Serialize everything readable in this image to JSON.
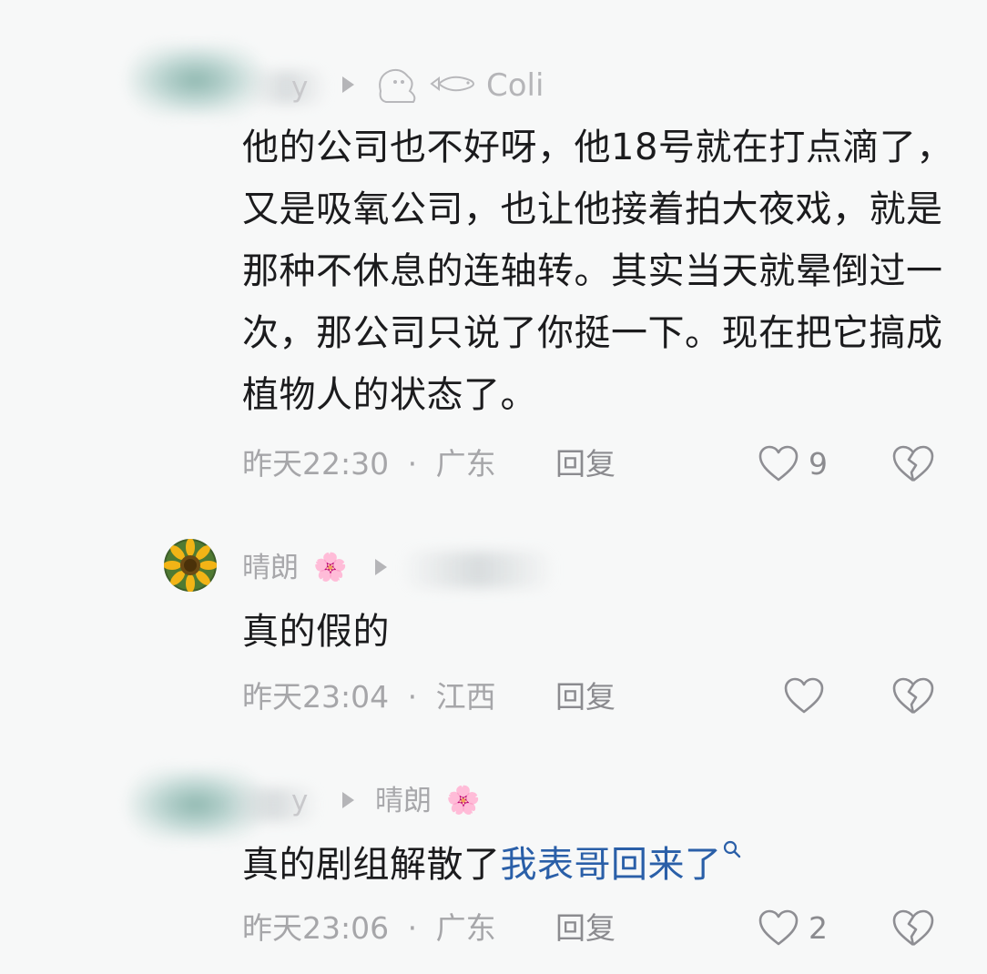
{
  "comments": [
    {
      "username": "y",
      "username_suffix": "Coli",
      "text": "他的公司也不好呀，他18号就在打点滴了，又是吸氧公司，也让他接着拍大夜戏，就是那种不休息的连轴转。其实当天就晕倒过一次，那公司只说了你挺一下。现在把它搞成植物人的状态了。",
      "time": "昨天22:30",
      "separator": "·",
      "location": "广东",
      "reply_label": "回复",
      "likes": "9"
    },
    {
      "username": "晴朗",
      "username_emoji": "🌸",
      "text": "真的假的",
      "time": "昨天23:04",
      "separator": "·",
      "location": "江西",
      "reply_label": "回复",
      "likes": ""
    },
    {
      "username": "y",
      "reply_to": "晴朗",
      "reply_to_emoji": "🌸",
      "text": "真的剧组解散了",
      "link_text": "我表哥回来了",
      "time": "昨天23:06",
      "separator": "·",
      "location": "广东",
      "reply_label": "回复",
      "likes": "2"
    }
  ],
  "icons": {
    "like": "heart-outline-icon",
    "dislike": "broken-heart-icon",
    "reply_arrow": "play-triangle-icon",
    "search": "search-icon"
  },
  "colors": {
    "link": "#2a5fa8",
    "meta": "#a6a6a9",
    "text": "#1b1b1d"
  }
}
